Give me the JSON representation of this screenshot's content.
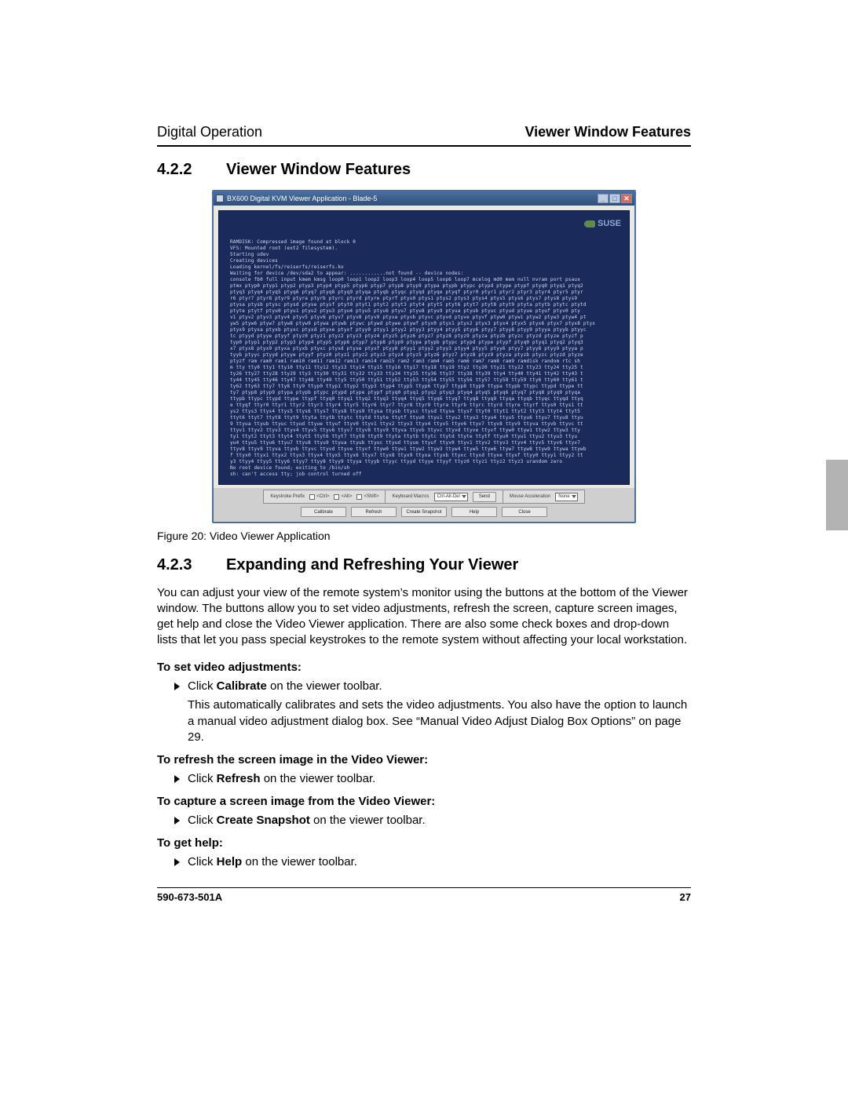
{
  "header": {
    "left": "Digital Operation",
    "right": "Viewer Window Features"
  },
  "section1": {
    "num": "4.2.2",
    "title": "Viewer Window Features"
  },
  "app": {
    "title": "BX600 Digital KVM Viewer Application - Blade-5",
    "logo": "SUSE",
    "terminal_lines": [
      "RAMDISK: Compressed image found at block 0",
      "VFS: Mounted root (ext2 filesystem).",
      "Starting udev",
      "Creating devices",
      "Loading kernel/fs/reiserfs/reiserfs.ko",
      "Waiting for device /dev/sda2 to appear: ............not found -- device nodes:",
      "console fb0 full input kmem kmsg loop0 loop1 loop2 loop3 loop4 loop5 loop6 loop7 mcelog md0 mem null nvram port psaux",
      "ptmx ptyp0 ptyp1 ptyp2 ptyp3 ptyp4 ptyp5 ptyp6 ptyp7 ptyp8 ptyp9 ptypa ptypb ptypc ptypd ptype ptypf ptyq0 ptyq1 ptyq2",
      "ptyq3 ptyq4 ptyq5 ptyq6 ptyq7 ptyq8 ptyq9 ptyqa ptyqb ptyqc ptyqd ptyqe ptyqf ptyr0 ptyr1 ptyr2 ptyr3 ptyr4 ptyr5 ptyr",
      "r6 ptyr7 ptyr8 ptyr9 ptyra ptyrb ptyrc ptyrd ptyre ptyrf ptys0 ptys1 ptys2 ptys3 ptys4 ptys5 ptys6 ptys7 ptys8 ptys9",
      "ptysa ptysb ptysc ptysd ptyse ptysf ptyt0 ptyt1 ptyt2 ptyt3 ptyt4 ptyt5 ptyt6 ptyt7 ptyt8 ptyt9 ptyta ptytb ptytc ptytd",
      "  ptyte ptytf ptyu0 ptyu1 ptyu2 ptyu3 ptyu4 ptyu5 ptyu6 ptyu7 ptyu8 ptyu9 ptyua ptyub ptyuc ptyud ptyue ptyuf ptyv0 pty",
      "v1 ptyv2 ptyv3 ptyv4 ptyv5 ptyv6 ptyv7 ptyv8 ptyv9 ptyva ptyvb ptyvc ptyvd ptyve ptyvf ptyw0 ptyw1 ptyw2 ptyw3 ptyw4 pt",
      "yw5 ptyw6 ptyw7 ptyw8 ptyw9 ptywa ptywb ptywc ptywd ptywe ptywf ptyx0 ptyx1 ptyx2 ptyx3 ptyx4 ptyx5 ptyx6 ptyx7 ptyx8 ptyx",
      "ptyx9 ptyxa ptyxb ptyxc ptyxd ptyxe ptyxf ptyy0 ptyy1 ptyy2 ptyy3 ptyy4 ptyy5 ptyy6 ptyy7 ptyy8 ptyy9 ptyya ptyyb ptyyc",
      "tc ptyyd ptyye ptyyf ptyz0 ptyz1 ptyz2 ptyz3 ptyz4 ptyz5 ptyz6 ptyz7 ptyz8 ptyz9 ptyza ptyzb ptyzc ptyzd ptyze ptyzf p",
      "typ0 ptyp1 ptyp2 ptyp3 ptyp4 ptyp5 ptyp6 ptyp7 ptyp8 ptyp9 ptypa ptypb ptypc ptypd ptype ptypf ptyq0 ptyq1 ptyq2 ptyq3",
      "x7 ptyx8 ptyx9 ptyxa ptyxb ptyxc ptyxd ptyxe ptyxf ptyy0 ptyy1 ptyy2 ptyy3 ptyy4 ptyy5 ptyy6 ptyy7 ptyy8 ptyy9 ptyya p",
      "tyyb ptyyc ptyyd ptyye ptyyf ptyz0 ptyz1 ptyz2 ptyz3 ptyz4 ptyz5 ptyz6 ptyz7 ptyz8 ptyz9 ptyza ptyzb ptyzc ptyzd ptyze",
      "ptyzf ram ram0 ram1 ram10 ram11 ram12 ram13 ram14 ram15 ram2 ram3 ram4 ram5 ram6 ram7 ram8 ram9 ramdisk random rtc sh",
      "m tty tty0 tty1 tty10 tty11 tty12 tty13 tty14 tty15 tty16 tty17 tty18 tty19 tty2 tty20 tty21 tty22 tty23 tty24 tty25 t",
      "ty26 tty27 tty28 tty29 tty3 tty30 tty31 tty32 tty33 tty34 tty35 tty36 tty37 tty38 tty39 tty4 tty40 tty41 tty42 tty43 t",
      "ty44 tty45 tty46 tty47 tty48 tty49 tty5 tty50 tty51 tty52 tty53 tty54 tty55 tty56 tty57 tty58 tty59 tty6 tty60 tty61 t",
      "ty62 tty63 tty7 tty8 tty9 ttyp0 ttyp1 ttyp2 ttyp3 ttyp4 ttyp5 ttyp6 ttyp7 ttyp8 ttyp9 ttypa ttypb ttypc ttypd ttype tt",
      "ty7 ptyp8 ptyp9 ptypa ptypb ptypc ptypd ptype ptypf ptyq0 ptyq1 ptyq2 ptyq3 ptyq4 ptyq5 ptyq6 ptyq7 ptyq8 ptyq9 ptyqa",
      "ttypb ttypc ttypd ttype ttypf ttyq0 ttyq1 ttyq2 ttyq3 ttyq4 ttyq5 ttyq6 ttyq7 ttyq8 ttyq9 ttyqa ttyqb ttyqc ttyqd ttyq",
      "e ttyqf ttyr0 ttyr1 ttyr2 ttyr3 ttyr4 ttyr5 ttyr6 ttyr7 ttyr8 ttyr9 ttyra ttyrb ttyrc ttyrd ttyre ttyrf ttys0 ttys1 tt",
      "ys2 ttys3 ttys4 ttys5 ttys6 ttys7 ttys8 ttys9 ttysa ttysb ttysc ttysd ttyse ttysf ttyt0 ttyt1 ttyt2 ttyt3 ttyt4 ttyt5",
      "ttyt6 ttyt7 ttyt8 ttyt9 ttyta ttytb ttytc ttytd ttyte ttytf ttyu0 ttyu1 ttyu2 ttyu3 ttyu4 ttyu5 ttyu6 ttyu7 ttyu8 ttyu",
      "9 ttyua ttyub ttyuc ttyud ttyue ttyuf ttyv0 ttyv1 ttyv2 ttyv3 ttyv4 ttyv5 ttyv6 ttyv7 ttyv8 ttyv9 ttyva ttyvb ttyvc tt",
      "ttyv1 ttyv2 ttyv3 ttyv4 ttyv5 ttyv6 ttyv7 ttyv8 ttyv9 ttyva ttyvb ttyvc ttyvd ttyve ttyvf ttyw0 ttyw1 ttyw2 ttyw3 tty",
      "ty1 ttyt2 ttyt3 ttyt4 ttyt5 ttyt6 ttyt7 ttyt8 ttyt9 ttyta ttytb ttytc ttytd ttyte ttytf ttyu0 ttyu1 ttyu2 ttyu3 ttyu",
      "yu4 ttyu5 ttyu6 ttyu7 ttyu8 ttyu9 ttyua ttyub ttyuc ttyud ttyue ttyuf ttyv0 ttyv1 ttyv2 ttyv3 ttyv4 ttyv5 ttyv6 ttyv7",
      "ttyv8 ttyv9 ttyva ttyvb ttyvc ttyvd ttyve ttyvf ttyw0 ttyw1 ttyw2 ttyw3 ttyw4 ttyw5 ttyw6 ttyw7 ttyw8 ttyw9 ttywa ttywb",
      "f ttyx0 ttyx1 ttyx2 ttyx3 ttyx4 ttyx5 ttyx6 ttyx7 ttyx8 ttyx9 ttyxa ttyxb ttyxc ttyxd ttyxe ttyxf ttyy0 ttyy1 ttyy2 tt",
      "y3 ttyy4 ttyy5 ttyy6 ttyy7 ttyy8 ttyy9 ttyya ttyyb ttyyc ttyyd ttyye ttyyf ttyz0 ttyz1 ttyz2 ttyz3 urandom zero",
      "No root device found; exiting to /bin/sh",
      "sh: can't access tty; job control turned off",
      "$"
    ],
    "groups": {
      "g1_title": "Keystroke Prefix",
      "g1_opts": [
        "<Ctrl>",
        "<Alt>",
        "<Shift>"
      ],
      "g2_title": "Keyboard Macros",
      "g2_drop": "Ctrl-Alt-Del",
      "g2_send": "Send",
      "g3_title": "Mouse Acceleration",
      "g3_drop": "None"
    },
    "buttons": [
      "Calibrate",
      "Refresh",
      "Create Snapshot",
      "Help",
      "Close"
    ]
  },
  "figcap": "Figure 20:  Video Viewer Application",
  "section2": {
    "num": "4.2.3",
    "title": "Expanding and Refreshing Your Viewer"
  },
  "para": "You can adjust your view of the remote system’s monitor using the buttons at the bottom of the Viewer window. The buttons allow you to set video adjustments, refresh the screen, capture screen images, get help and close the Video Viewer application. There are also some check boxes and drop-down lists that let you pass special keystrokes to the remote system without affecting your local workstation.",
  "tasks": {
    "t1_head": "To set video adjustments:",
    "t1_a": "Click ",
    "t1_b": "Calibrate",
    "t1_c": " on the viewer toolbar.",
    "t1_d": "This automatically calibrates and sets the video adjustments. You also have the option to launch a manual video adjustment dialog box. See “Manual Video Adjust Dialog Box Options” on page 29.",
    "t2_head": "To refresh the screen image in the Video Viewer:",
    "t2_a": "Click ",
    "t2_b": "Refresh",
    "t2_c": " on the viewer toolbar.",
    "t3_head": "To capture a screen image from the Video Viewer:",
    "t3_a": "Click ",
    "t3_b": "Create Snapshot",
    "t3_c": " on the viewer toolbar.",
    "t4_head": "To get help:",
    "t4_a": "Click ",
    "t4_b": "Help",
    "t4_c": " on the viewer toolbar."
  },
  "footer": {
    "left": "590-673-501A",
    "right": "27"
  }
}
